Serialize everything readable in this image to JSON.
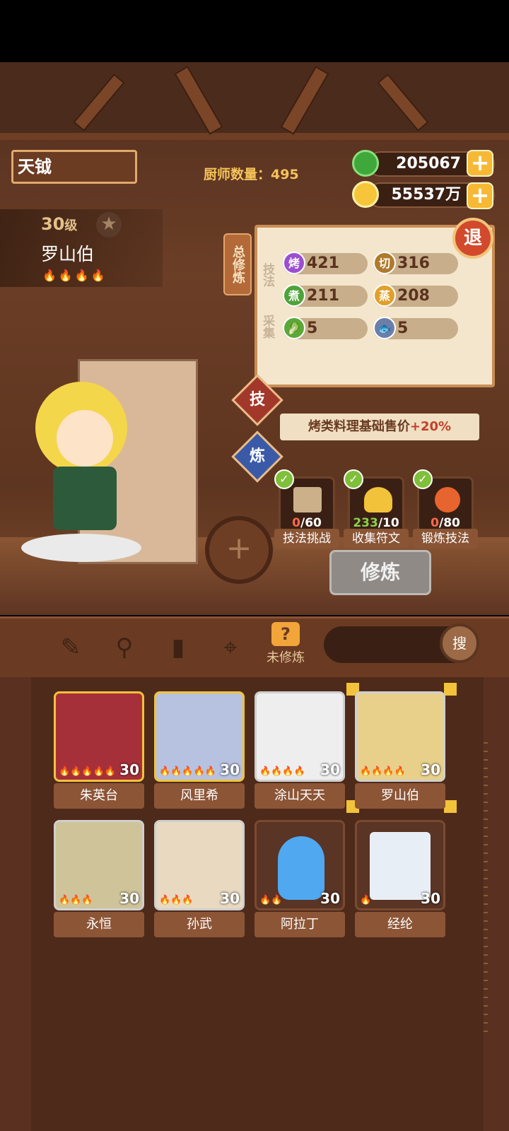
{
  "player": {
    "name": "天钺"
  },
  "chef_count": "厨师数量：495",
  "currency": {
    "jade": "205067",
    "coins": "55537万"
  },
  "hero": {
    "level": "30",
    "level_unit": "级",
    "name": "罗山伯",
    "flames": "🔥🔥🔥🔥"
  },
  "panel": {
    "tab": "总修炼",
    "section_skill": "技法",
    "section_collect": "采集",
    "stats": [
      {
        "icon": "烤",
        "value": "421",
        "color": "#9b4fd0"
      },
      {
        "icon": "切",
        "value": "316",
        "color": "#b07a2a"
      },
      {
        "icon": "煮",
        "value": "211",
        "color": "#4ea33a"
      },
      {
        "icon": "蒸",
        "value": "208",
        "color": "#e0a02a"
      },
      {
        "icon": "🥬",
        "value": "5",
        "color": "#5aa83a"
      },
      {
        "icon": "🐟",
        "value": "5",
        "color": "#6c7fa8"
      }
    ],
    "exit": "退"
  },
  "buttons": {
    "skill": "技",
    "refine": "炼",
    "cultivate": "修炼",
    "add": "+",
    "search": "搜"
  },
  "bonus": {
    "text": "烤类料理基础售价",
    "value": "+20%"
  },
  "tasks": [
    {
      "count_done": "0",
      "count_total": "/60",
      "label": "技法挑战",
      "done_color": "#ff6a4a"
    },
    {
      "count_done": "233",
      "count_total": "/10",
      "label": "收集符文",
      "done_color": "#8bd14a"
    },
    {
      "count_done": "0",
      "count_total": "/80",
      "label": "锻炼技法",
      "done_color": "#ff6a4a"
    }
  ],
  "filter": {
    "active_label": "未修炼"
  },
  "chefs": [
    {
      "name": "朱英台",
      "level": "30",
      "flames": "🔥🔥🔥🔥🔥",
      "bg": "#a6303a",
      "border": "gold"
    },
    {
      "name": "风里希",
      "level": "30",
      "flames": "🔥🔥🔥🔥🔥",
      "bg": "#b6c2e0",
      "border": "gold"
    },
    {
      "name": "涂山天天",
      "level": "30",
      "flames": "🔥🔥🔥🔥",
      "bg": "#eeeeee",
      "border": "silver"
    },
    {
      "name": "罗山伯",
      "level": "30",
      "flames": "🔥🔥🔥🔥",
      "bg": "#e8d08a",
      "border": "silver"
    },
    {
      "name": "永恒",
      "level": "30",
      "flames": "🔥🔥🔥",
      "bg": "#cfc39a",
      "border": "silver"
    },
    {
      "name": "孙武",
      "level": "30",
      "flames": "🔥🔥🔥",
      "bg": "#e8d9c0",
      "border": "silver"
    },
    {
      "name": "阿拉丁",
      "level": "30",
      "flames": "🔥🔥",
      "bg": "#5a3424",
      "border": "brown"
    },
    {
      "name": "经纶",
      "level": "30",
      "flames": "🔥",
      "bg": "#5a3424",
      "border": "brown"
    }
  ]
}
